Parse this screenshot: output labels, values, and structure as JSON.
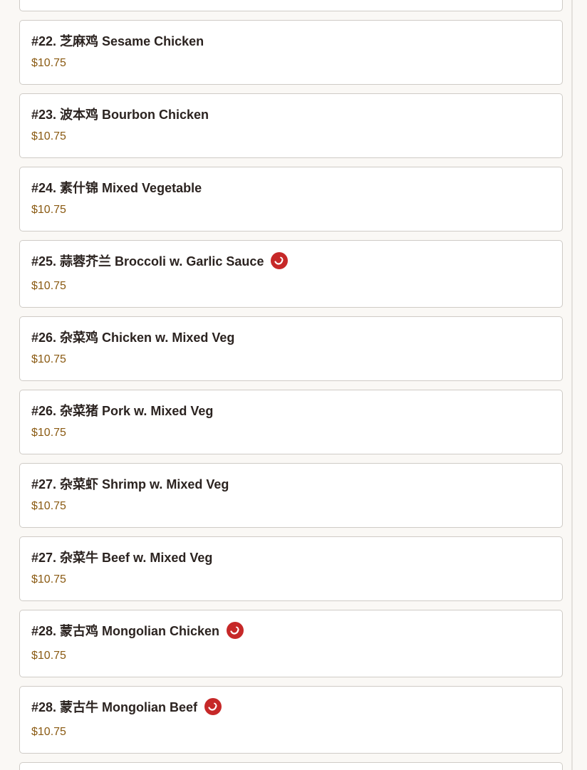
{
  "colors": {
    "title": "#2b2320",
    "price": "#8a5a12",
    "spicy_badge": "#c62828"
  },
  "menu_items": [
    {
      "name": "#22. 芝麻鸡 Sesame Chicken",
      "price": "$10.75",
      "spicy": false
    },
    {
      "name": "#23. 波本鸡 Bourbon Chicken",
      "price": "$10.75",
      "spicy": false
    },
    {
      "name": "#24. 素什锦 Mixed Vegetable",
      "price": "$10.75",
      "spicy": false
    },
    {
      "name": "#25. 蒜蓉芥兰 Broccoli w. Garlic Sauce",
      "price": "$10.75",
      "spicy": true
    },
    {
      "name": "#26. 杂菜鸡 Chicken w. Mixed Veg",
      "price": "$10.75",
      "spicy": false
    },
    {
      "name": "#26. 杂菜猪 Pork w. Mixed Veg",
      "price": "$10.75",
      "spicy": false
    },
    {
      "name": "#27. 杂菜虾 Shrimp w. Mixed Veg",
      "price": "$10.75",
      "spicy": false
    },
    {
      "name": "#27. 杂菜牛 Beef w. Mixed Veg",
      "price": "$10.75",
      "spicy": false
    },
    {
      "name": "#28. 蒙古鸡 Mongolian Chicken",
      "price": "$10.75",
      "spicy": true
    },
    {
      "name": "#28. 蒙古牛 Mongolian Beef",
      "price": "$10.75",
      "spicy": true
    }
  ]
}
